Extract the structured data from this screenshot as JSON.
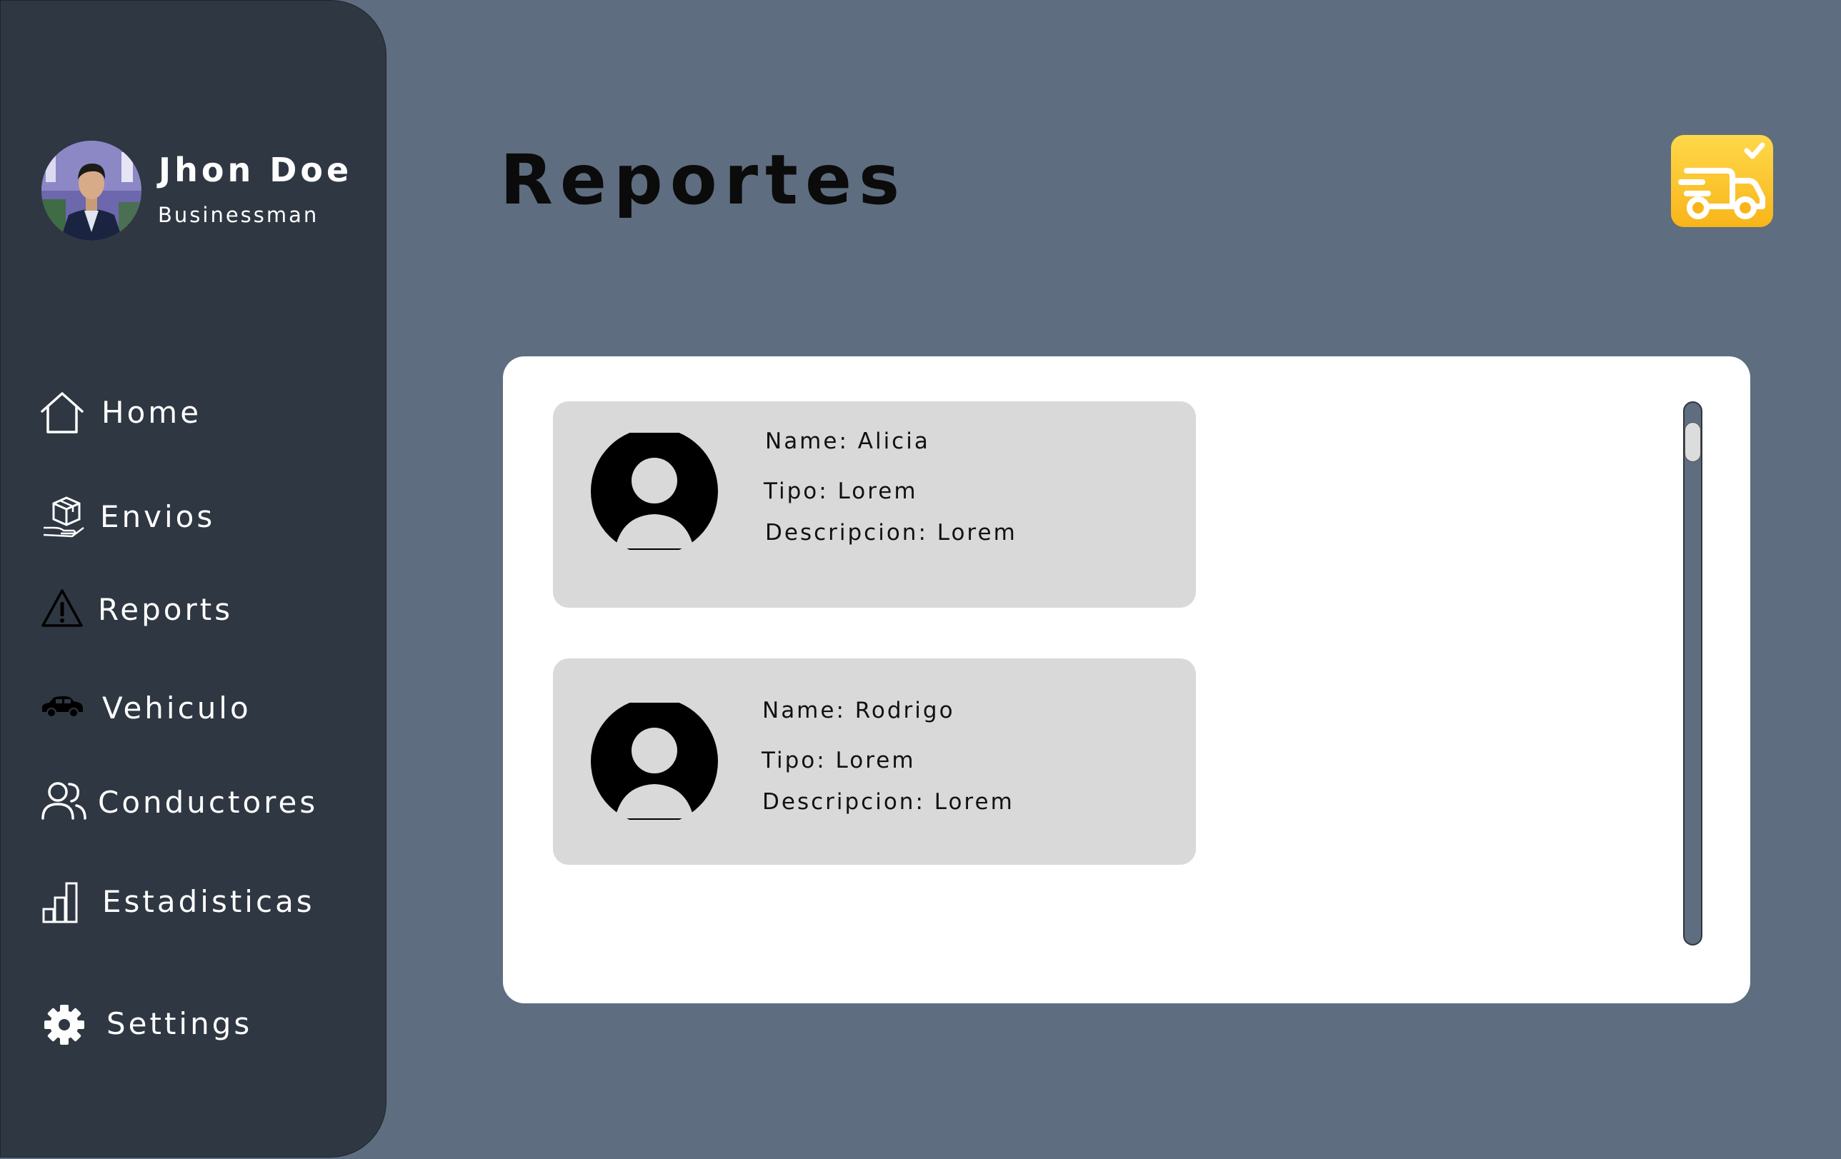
{
  "user": {
    "name": "Jhon Doe",
    "role": "Businessman"
  },
  "nav": {
    "home": "Home",
    "envios": "Envios",
    "reports": "Reports",
    "vehiculo": "Vehiculo",
    "conductores": "Conductores",
    "estadisticas": "Estadisticas",
    "settings": "Settings"
  },
  "page": {
    "title": "Reportes"
  },
  "reports": [
    {
      "name": "Name: Alicia",
      "tipo": "Tipo: Lorem",
      "descripcion": "Descripcion: Lorem"
    },
    {
      "name": "Name: Rodrigo",
      "tipo": "Tipo: Lorem",
      "descripcion": "Descripcion: Lorem"
    }
  ],
  "colors": {
    "background": "#5e6d7f",
    "sidebar": "#2f3742",
    "panel": "#ffffff",
    "card": "#d9d9d9",
    "accent": "#f8b51a"
  },
  "icons": {
    "home": "house-icon",
    "envios": "package-hand-icon",
    "reports": "warning-triangle-icon",
    "vehiculo": "car-icon",
    "conductores": "users-icon",
    "estadisticas": "bar-chart-icon",
    "settings": "gear-icon",
    "brand": "delivery-truck-icon"
  }
}
